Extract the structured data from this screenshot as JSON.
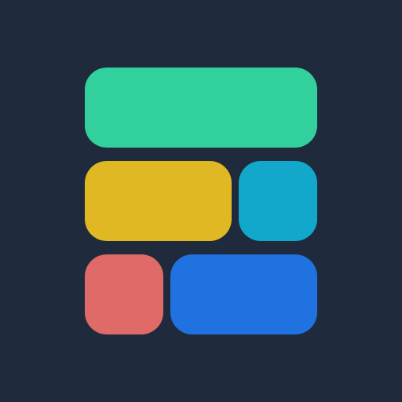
{
  "colors": {
    "background": "#1f2a3c",
    "tiles": {
      "top": "#31d09c",
      "middle_left": "#e0b823",
      "middle_right": "#12a8cb",
      "bottom_left": "#e06a67",
      "bottom_right": "#1f72e0"
    }
  },
  "icon": "layout-grid-icon"
}
